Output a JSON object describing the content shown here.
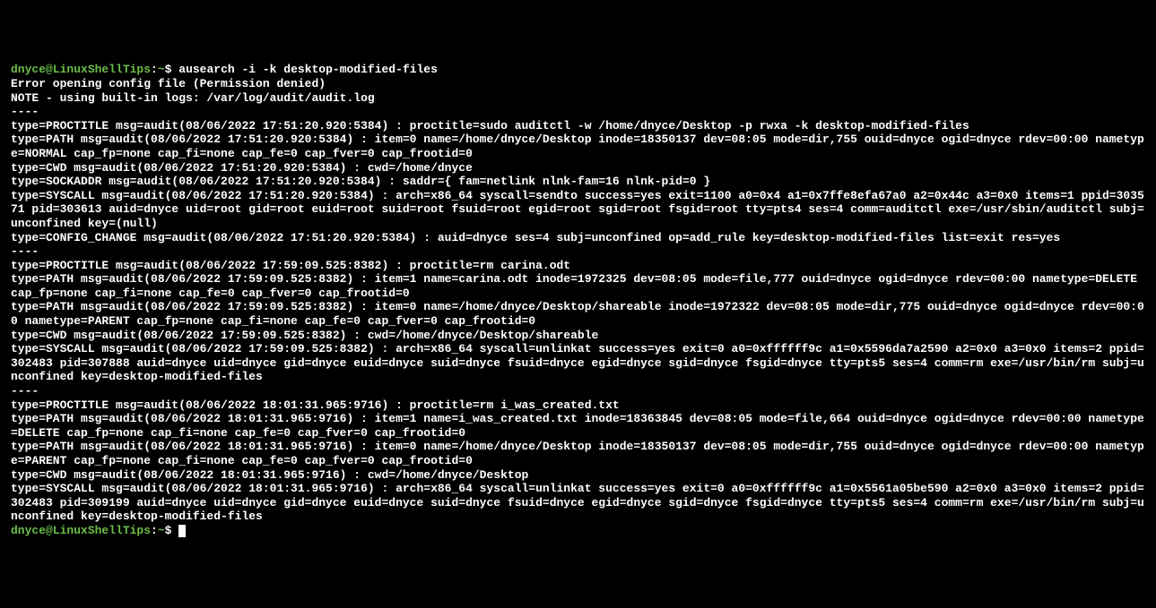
{
  "prompt": {
    "userhost": "dnyce@LinuxShellTips",
    "sep": ":",
    "path": "~",
    "dollar": "$ "
  },
  "command": "ausearch -i -k desktop-modified-files",
  "lines": [
    "Error opening config file (Permission denied)",
    "NOTE - using built-in logs: /var/log/audit/audit.log",
    "----",
    "type=PROCTITLE msg=audit(08/06/2022 17:51:20.920:5384) : proctitle=sudo auditctl -w /home/dnyce/Desktop -p rwxa -k desktop-modified-files",
    "type=PATH msg=audit(08/06/2022 17:51:20.920:5384) : item=0 name=/home/dnyce/Desktop inode=18350137 dev=08:05 mode=dir,755 ouid=dnyce ogid=dnyce rdev=00:00 nametype=NORMAL cap_fp=none cap_fi=none cap_fe=0 cap_fver=0 cap_frootid=0",
    "type=CWD msg=audit(08/06/2022 17:51:20.920:5384) : cwd=/home/dnyce",
    "type=SOCKADDR msg=audit(08/06/2022 17:51:20.920:5384) : saddr={ fam=netlink nlnk-fam=16 nlnk-pid=0 }",
    "type=SYSCALL msg=audit(08/06/2022 17:51:20.920:5384) : arch=x86_64 syscall=sendto success=yes exit=1100 a0=0x4 a1=0x7ffe8efa67a0 a2=0x44c a3=0x0 items=1 ppid=303571 pid=303613 auid=dnyce uid=root gid=root euid=root suid=root fsuid=root egid=root sgid=root fsgid=root tty=pts4 ses=4 comm=auditctl exe=/usr/sbin/auditctl subj=unconfined key=(null)",
    "type=CONFIG_CHANGE msg=audit(08/06/2022 17:51:20.920:5384) : auid=dnyce ses=4 subj=unconfined op=add_rule key=desktop-modified-files list=exit res=yes",
    "----",
    "type=PROCTITLE msg=audit(08/06/2022 17:59:09.525:8382) : proctitle=rm carina.odt",
    "type=PATH msg=audit(08/06/2022 17:59:09.525:8382) : item=1 name=carina.odt inode=1972325 dev=08:05 mode=file,777 ouid=dnyce ogid=dnyce rdev=00:00 nametype=DELETE cap_fp=none cap_fi=none cap_fe=0 cap_fver=0 cap_frootid=0",
    "type=PATH msg=audit(08/06/2022 17:59:09.525:8382) : item=0 name=/home/dnyce/Desktop/shareable inode=1972322 dev=08:05 mode=dir,775 ouid=dnyce ogid=dnyce rdev=00:00 nametype=PARENT cap_fp=none cap_fi=none cap_fe=0 cap_fver=0 cap_frootid=0",
    "type=CWD msg=audit(08/06/2022 17:59:09.525:8382) : cwd=/home/dnyce/Desktop/shareable",
    "type=SYSCALL msg=audit(08/06/2022 17:59:09.525:8382) : arch=x86_64 syscall=unlinkat success=yes exit=0 a0=0xffffff9c a1=0x5596da7a2590 a2=0x0 a3=0x0 items=2 ppid=302483 pid=307888 auid=dnyce uid=dnyce gid=dnyce euid=dnyce suid=dnyce fsuid=dnyce egid=dnyce sgid=dnyce fsgid=dnyce tty=pts5 ses=4 comm=rm exe=/usr/bin/rm subj=unconfined key=desktop-modified-files",
    "----",
    "type=PROCTITLE msg=audit(08/06/2022 18:01:31.965:9716) : proctitle=rm i_was_created.txt",
    "type=PATH msg=audit(08/06/2022 18:01:31.965:9716) : item=1 name=i_was_created.txt inode=18363845 dev=08:05 mode=file,664 ouid=dnyce ogid=dnyce rdev=00:00 nametype=DELETE cap_fp=none cap_fi=none cap_fe=0 cap_fver=0 cap_frootid=0",
    "type=PATH msg=audit(08/06/2022 18:01:31.965:9716) : item=0 name=/home/dnyce/Desktop inode=18350137 dev=08:05 mode=dir,755 ouid=dnyce ogid=dnyce rdev=00:00 nametype=PARENT cap_fp=none cap_fi=none cap_fe=0 cap_fver=0 cap_frootid=0",
    "type=CWD msg=audit(08/06/2022 18:01:31.965:9716) : cwd=/home/dnyce/Desktop",
    "type=SYSCALL msg=audit(08/06/2022 18:01:31.965:9716) : arch=x86_64 syscall=unlinkat success=yes exit=0 a0=0xffffff9c a1=0x5561a05be590 a2=0x0 a3=0x0 items=2 ppid=302483 pid=309199 auid=dnyce uid=dnyce gid=dnyce euid=dnyce suid=dnyce fsuid=dnyce egid=dnyce sgid=dnyce fsgid=dnyce tty=pts5 ses=4 comm=rm exe=/usr/bin/rm subj=unconfined key=desktop-modified-files"
  ]
}
